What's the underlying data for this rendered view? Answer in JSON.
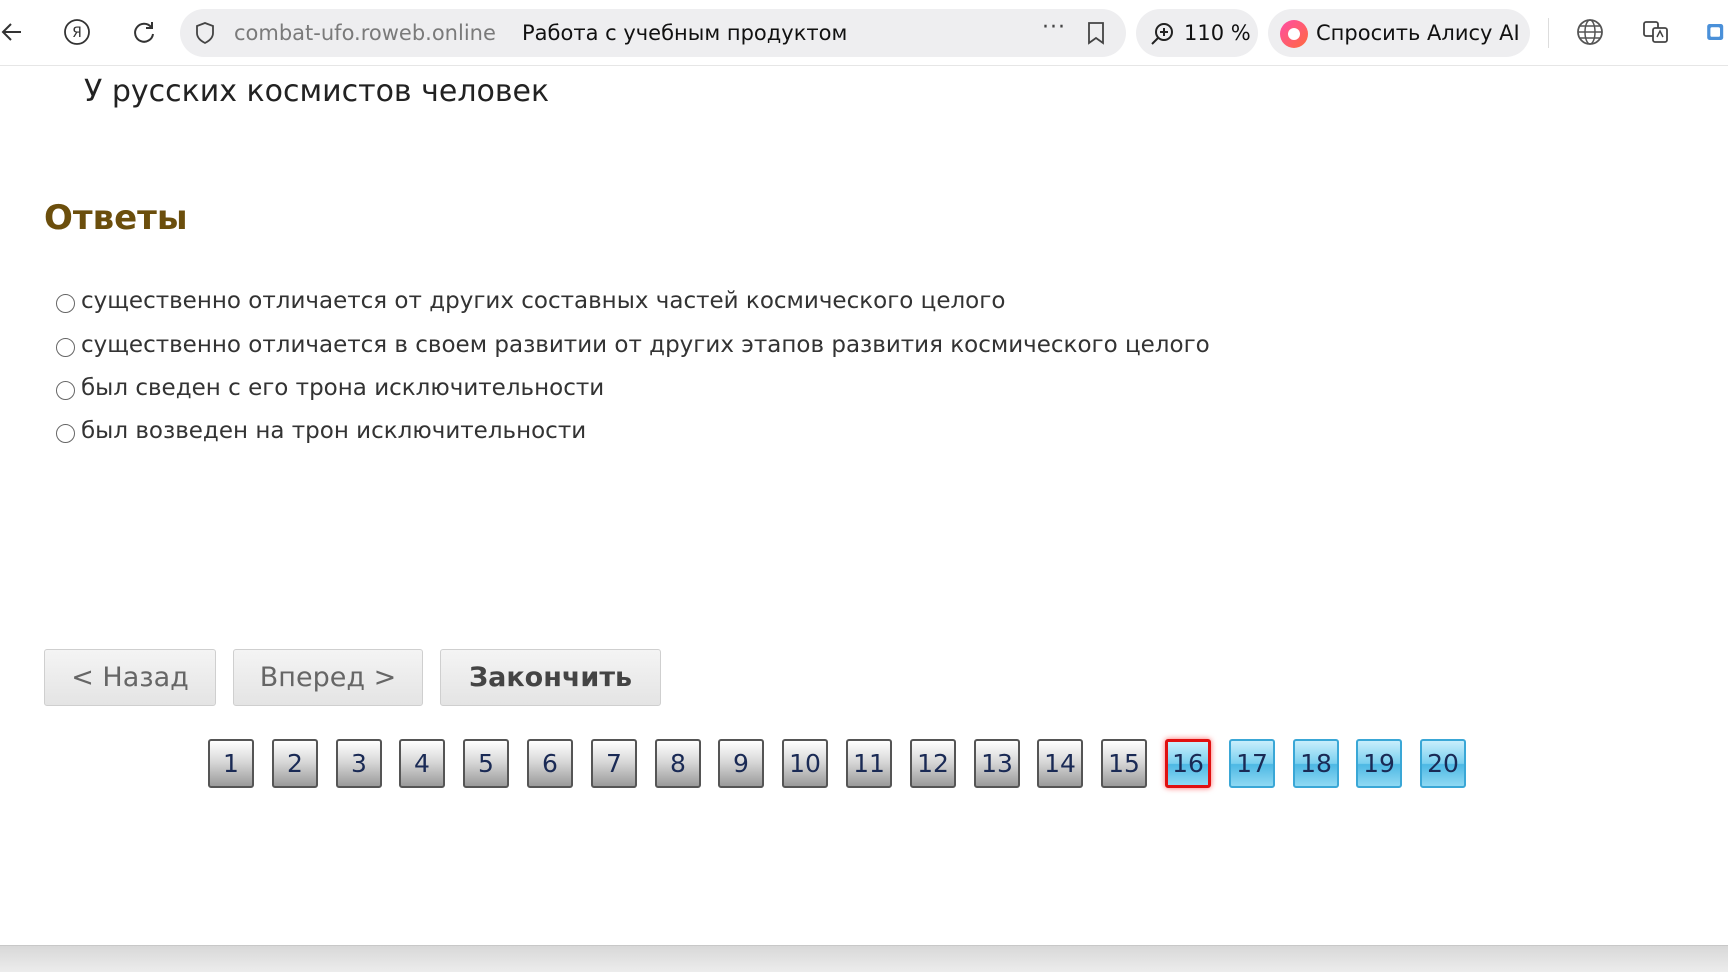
{
  "browser": {
    "domain": "combat-ufo.roweb.online",
    "page_title": "Работа с учебным продуктом",
    "zoom": "110 %",
    "alice_label": "Спросить Алису AI",
    "more_dots": "···"
  },
  "question": {
    "text": "У русских космистов человек"
  },
  "answers": {
    "heading": "Ответы",
    "options": [
      "существенно отличается от других составных частей космического целого",
      "существенно отличается в своем развитии от других этапов развития космического целого",
      "был сведен с его трона исключительности",
      "был возведен на трон исключительности"
    ]
  },
  "nav": {
    "back_label": "< Назад",
    "forward_label": "Вперед >",
    "finish_label": "Закончить"
  },
  "pager": {
    "pages": [
      "1",
      "2",
      "3",
      "4",
      "5",
      "6",
      "7",
      "8",
      "9",
      "10",
      "11",
      "12",
      "13",
      "14",
      "15",
      "16",
      "17",
      "18",
      "19",
      "20"
    ],
    "current": "16",
    "done_color": "#9a9a9a",
    "todo_color": "#4db8e4",
    "current_border": "#e01010"
  }
}
